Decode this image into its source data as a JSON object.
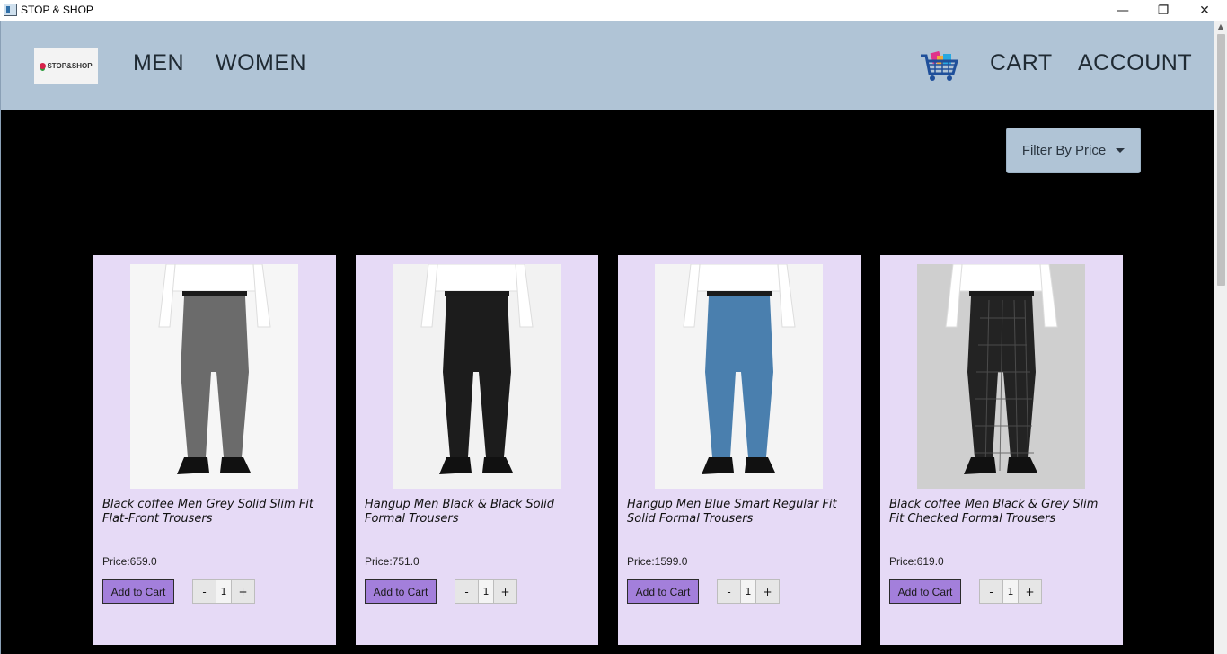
{
  "window": {
    "title": "STOP & SHOP",
    "minimize": "—",
    "restore": "❐",
    "close": "✕"
  },
  "nav": {
    "logo_text": "STOP&SHOP",
    "men": "MEN",
    "women": "WOMEN",
    "cart": "CART",
    "account": "ACCOUNT"
  },
  "filter": {
    "label": "Filter By Price"
  },
  "colors": {
    "navbar": "#b0c4d6",
    "card": "#e6daf6",
    "button": "#a37fdb",
    "background": "#000000"
  },
  "products": [
    {
      "title": "Black coffee Men Grey Solid Slim Fit Flat-Front Trousers",
      "price": "Price:659.0",
      "add": "Add to Cart",
      "qty": "1",
      "minus": "-",
      "plus": "+",
      "trouser_color": "#6b6b6b",
      "bg": "#f6f6f6"
    },
    {
      "title": "Hangup Men Black & Black Solid Formal Trousers",
      "price": "Price:751.0",
      "add": "Add to Cart",
      "qty": "1",
      "minus": "-",
      "plus": "+",
      "trouser_color": "#1c1c1c",
      "bg": "#f2f2f2"
    },
    {
      "title": "Hangup Men Blue Smart Regular Fit Solid Formal Trousers",
      "price": "Price:1599.0",
      "add": "Add to Cart",
      "qty": "1",
      "minus": "-",
      "plus": "+",
      "trouser_color": "#4a7fae",
      "bg": "#f4f4f4"
    },
    {
      "title": "Black coffee Men Black & Grey Slim Fit Checked Formal Trousers",
      "price": "Price:619.0",
      "add": "Add to Cart",
      "qty": "1",
      "minus": "-",
      "plus": "+",
      "trouser_color": "#232323",
      "bg": "#cfcfcf"
    }
  ]
}
